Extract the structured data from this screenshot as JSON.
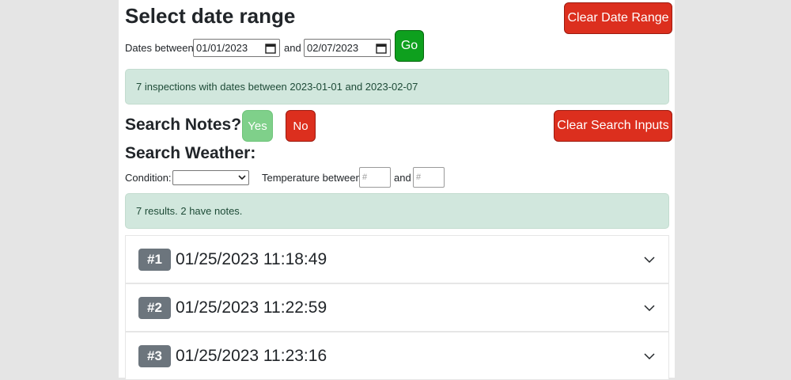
{
  "date_range": {
    "title": "Select date range",
    "clear_label": "Clear Date Range",
    "dates_between_label": "Dates between",
    "start_value": "01/01/2023",
    "and_label": "and",
    "end_value": "02/07/2023",
    "go_label": "Go",
    "result_text": "7 inspections with dates between 2023-01-01 and 2023-02-07"
  },
  "search": {
    "notes_label": "Search Notes?",
    "yes_label": "Yes",
    "no_label": "No",
    "clear_label": "Clear Search Inputs",
    "weather_label": "Search Weather:",
    "condition_label": "Condition:",
    "condition_value": "",
    "temperature_label": "Temperature between",
    "and_label": "and",
    "temp_min_placeholder": "#",
    "temp_max_placeholder": "#",
    "result_text": "7 results. 2 have notes."
  },
  "inspections": [
    {
      "badge": "#1",
      "datetime": "01/25/2023 11:18:49"
    },
    {
      "badge": "#2",
      "datetime": "01/25/2023 11:22:59"
    },
    {
      "badge": "#3",
      "datetime": "01/25/2023 11:23:16"
    }
  ],
  "colors": {
    "danger": "#dc2f1e",
    "success": "#0ea01e",
    "success_light": "#7fd08a",
    "alert_bg": "#d1e7dd",
    "badge_bg": "#6c757d"
  },
  "icons": [
    "calendar-icon",
    "chevron-down-icon",
    "select-arrow-icon"
  ]
}
